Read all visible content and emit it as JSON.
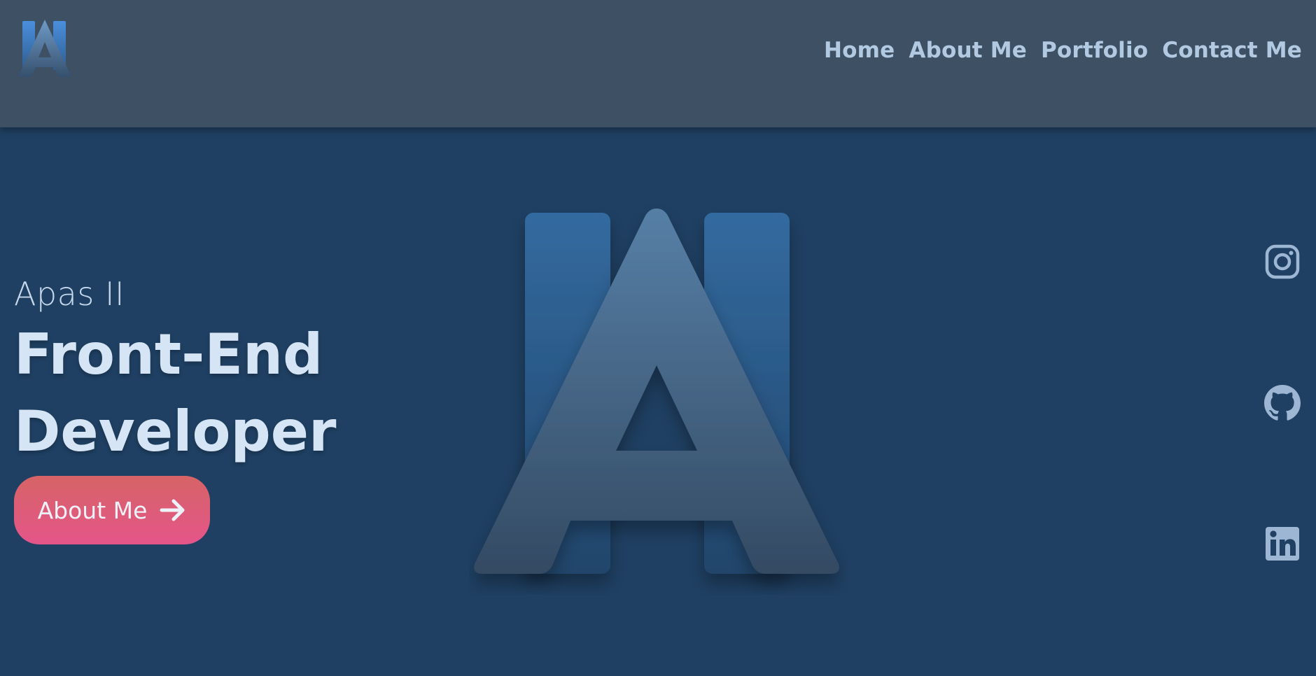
{
  "nav": {
    "logo_icon": "letter-a-logo",
    "links": [
      {
        "label": "Home"
      },
      {
        "label": "About Me"
      },
      {
        "label": "Portfolio"
      },
      {
        "label": "Contact Me"
      }
    ]
  },
  "hero": {
    "subtitle": "Apas II",
    "title_line1": "Front-End",
    "title_line2": "Developer",
    "cta_label": "About Me",
    "cta_icon": "arrow-right-icon",
    "background_icon": "letter-a-logo"
  },
  "social": [
    {
      "name": "instagram-icon"
    },
    {
      "name": "github-icon"
    },
    {
      "name": "linkedin-icon"
    }
  ],
  "colors": {
    "page_bg": "#1f4063",
    "navbar_bg": "#3d5064",
    "nav_text": "#b2c9e2",
    "headline_text": "#d6e5f5",
    "cta_gradient_top": "#d66466",
    "cta_gradient_bottom": "#e5558a",
    "social_icon": "#9db6d3"
  }
}
